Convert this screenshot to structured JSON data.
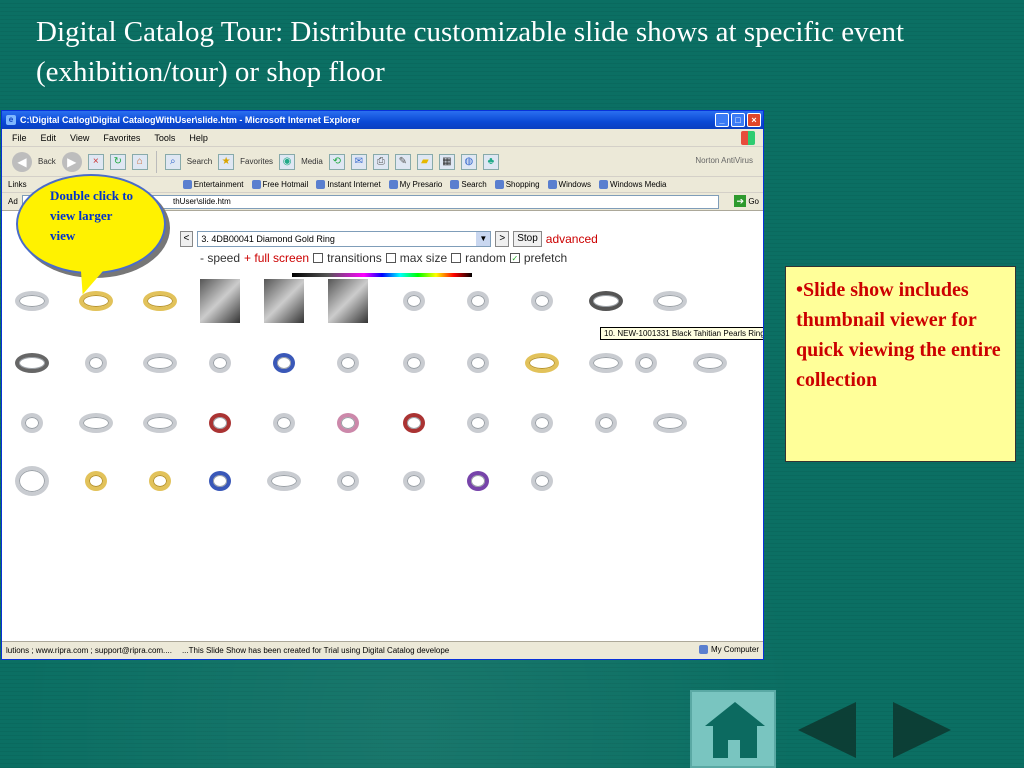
{
  "slide": {
    "title": "Digital Catalog Tour:  Distribute customizable slide shows at specific event (exhibition/tour) or shop floor"
  },
  "browser": {
    "title": "C:\\Digital Catlog\\Digital CatalogWithUser\\slide.htm - Microsoft Internet Explorer",
    "menu": [
      "File",
      "Edit",
      "View",
      "Favorites",
      "Tools",
      "Help"
    ],
    "toolbar": {
      "back": "Back",
      "search": "Search",
      "favorites": "Favorites",
      "media": "Media",
      "norton": "Norton AntiVirus"
    },
    "links_label": "Links",
    "links": [
      "Entertainment",
      "Free Hotmail",
      "Instant Internet",
      "My Presario",
      "Search",
      "Shopping",
      "Windows",
      "Windows Media"
    ],
    "address_label": "Ad",
    "address_value": "thUser\\slide.htm",
    "go_label": "Go",
    "status_left": "lutions ; www.ripra.com ; support@ripra.com....",
    "status_mid": "...This Slide Show has been created for Trial using Digital Catalog develope",
    "status_zone": "My Computer"
  },
  "viewer": {
    "prefix": "s",
    "prev": "<",
    "selected_item": "3. 4DB00041 Diamond Gold Ring",
    "next": ">",
    "stop": "Stop",
    "advanced": "advanced",
    "speed": "- speed",
    "full_screen": "+ full screen",
    "options": [
      {
        "label": "transitions",
        "checked": false
      },
      {
        "label": "max size",
        "checked": false
      },
      {
        "label": "random",
        "checked": false
      },
      {
        "label": "prefetch",
        "checked": true
      }
    ],
    "tooltip": "10. NEW-1001331 Black Tahitian Pearls Ring"
  },
  "callout": {
    "text": "Double click to view larger view"
  },
  "note": {
    "text": "•Slide show includes thumbnail viewer for quick viewing the entire collection"
  },
  "colors": {
    "background": "#0b6f63",
    "callout_fill": "#fff200",
    "callout_text": "#0033cc",
    "note_fill": "#ffff99",
    "note_text": "#cc0000"
  },
  "icons": [
    "home-icon",
    "prev-arrow-icon",
    "next-arrow-icon"
  ]
}
